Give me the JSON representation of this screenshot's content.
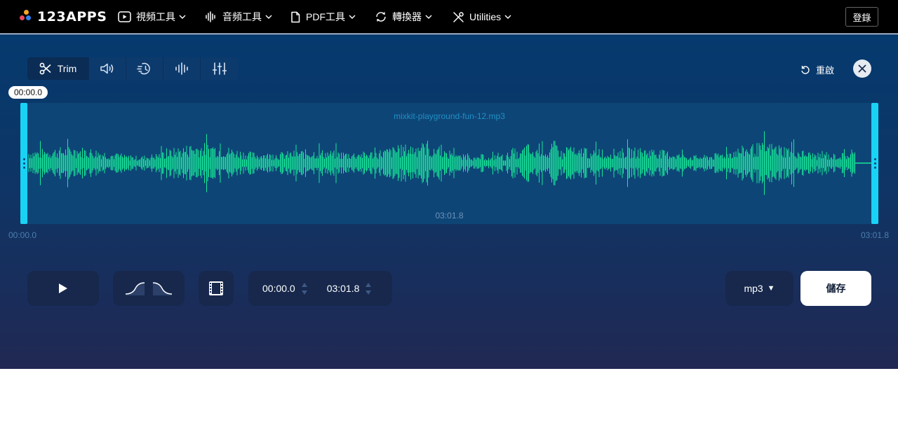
{
  "colors": {
    "accent": "#19d3f5",
    "waveform": "#17e897",
    "logo_dots": [
      "#f5a623",
      "#e84a5f",
      "#2f80ed"
    ]
  },
  "header": {
    "brand": "123APPS",
    "nav": [
      {
        "label": "視頻工具",
        "icon": "play-square-icon"
      },
      {
        "label": "音頻工具",
        "icon": "audio-wave-icon"
      },
      {
        "label": "PDF工具",
        "icon": "document-icon"
      },
      {
        "label": "轉換器",
        "icon": "convert-icon"
      },
      {
        "label": "Utilities",
        "icon": "tools-icon"
      }
    ],
    "login_label": "登錄"
  },
  "toolbar": {
    "tools": [
      {
        "label": "Trim",
        "icon": "scissors-icon",
        "active": true
      },
      {
        "label": "",
        "icon": "volume-icon"
      },
      {
        "label": "",
        "icon": "speed-icon"
      },
      {
        "label": "",
        "icon": "waveform-icon"
      },
      {
        "label": "",
        "icon": "equalizer-icon"
      }
    ],
    "reset_label": "重啟"
  },
  "waveform": {
    "file_name": "mixkit-playground-fun-12.mp3",
    "playhead": "00:00.0",
    "duration_center": "03:01.8",
    "start_label": "00:00.0",
    "end_label": "03:01.8"
  },
  "controls": {
    "start_time": "00:00.0",
    "end_time": "03:01.8",
    "format": "mp3",
    "format_caret": "▼",
    "save_label": "儲存"
  }
}
